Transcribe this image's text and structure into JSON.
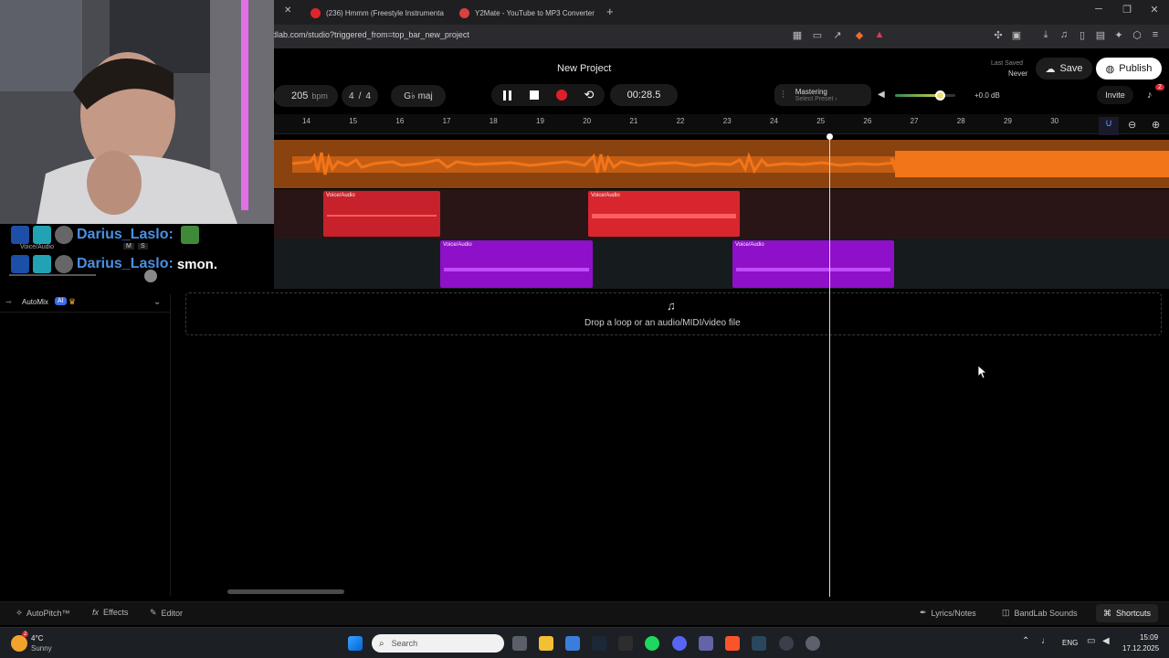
{
  "browser": {
    "tabs": [
      {
        "label": "(236) Hmmm (Freestyle Instrumenta"
      },
      {
        "label": "Y2Mate - YouTube to MP3 Converter"
      }
    ],
    "new_tab": "+",
    "url": "dlab.com/studio?triggered_from=top_bar_new_project",
    "window_controls": {
      "minimize": "─",
      "maximize": "❐",
      "close": "✕"
    }
  },
  "studio": {
    "project_title": "New Project",
    "last_saved_label": "Last Saved",
    "last_saved_value": "Never",
    "save_label": "Save",
    "publish_label": "Publish",
    "invite_label": "Invite",
    "notification_count": "2",
    "tempo": "205",
    "tempo_unit": "bpm",
    "time_sig_top": "4",
    "time_sig_sep": "/",
    "time_sig_bottom": "4",
    "key": "G♭ maj",
    "time": "00:28.5",
    "mastering_label": "Mastering",
    "mastering_preset": "Select Preset ›",
    "master_volume_db": "+0.0 dB",
    "master_volume_level": 0.8
  },
  "ruler": {
    "ticks": [
      "14",
      "15",
      "16",
      "17",
      "18",
      "19",
      "20",
      "21",
      "22",
      "23",
      "24",
      "25",
      "26",
      "27",
      "28",
      "29",
      "30"
    ]
  },
  "tracks": {
    "track2_clips": [
      {
        "label": "Voice/Audio"
      },
      {
        "label": "Voice/Audio"
      }
    ],
    "track3_clips": [
      {
        "label": "Voice/Audio"
      },
      {
        "label": "Voice/Audio"
      }
    ],
    "track2_name": "Voice/Audio",
    "track_mute": "M",
    "track_solo": "S"
  },
  "automix": {
    "label": "AutoMix",
    "badge": "AI"
  },
  "dropzone": {
    "text": "Drop a loop or an audio/MIDI/video file"
  },
  "bottom_bar": {
    "autopitch": "AutoPitch™",
    "effects": "Effects",
    "editor": "Editor",
    "lyrics": "Lyrics/Notes",
    "sounds": "BandLab Sounds",
    "shortcuts": "Shortcuts"
  },
  "chat": [
    {
      "user": "Darius_Laslo:",
      "message": ""
    },
    {
      "user": "Darius_Laslo:",
      "message": "smon."
    }
  ],
  "taskbar": {
    "weather_temp": "4°C",
    "weather_desc": "Sunny",
    "search_placeholder": "Search",
    "language": "ENG",
    "time": "15:09",
    "date": "17.12.2025",
    "weather_badge": "2"
  },
  "colors": {
    "accent_orange": "#f2751a",
    "clip_red": "#d9262e",
    "clip_purple": "#8e10c9",
    "chat_blue": "#4a90e2"
  }
}
